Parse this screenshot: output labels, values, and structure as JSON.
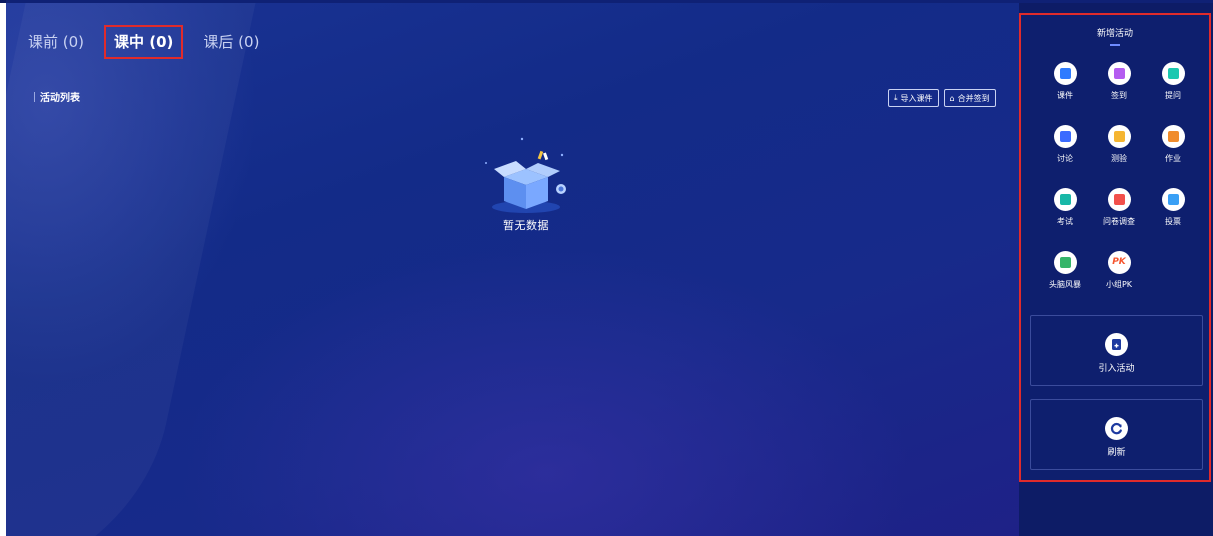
{
  "tabs": [
    {
      "label": "课前 (0)",
      "active": false
    },
    {
      "label": "课中 (0)",
      "active": true
    },
    {
      "label": "课后 (0)",
      "active": false
    }
  ],
  "main": {
    "list_title": "活动列表",
    "import_button": "导入课件",
    "merge_button": "合并签到",
    "empty_text": "暂无数据"
  },
  "panel": {
    "title": "新增活动",
    "activities": [
      {
        "label": "课件",
        "icon": "courseware-icon",
        "color": "#2f7bff"
      },
      {
        "label": "签到",
        "icon": "signin-icon",
        "color": "#b45cf0"
      },
      {
        "label": "提问",
        "icon": "question-icon",
        "color": "#1cc8b0"
      },
      {
        "label": "讨论",
        "icon": "discussion-icon",
        "color": "#3b6bff"
      },
      {
        "label": "测验",
        "icon": "quiz-icon",
        "color": "#f5b531"
      },
      {
        "label": "作业",
        "icon": "homework-icon",
        "color": "#f08c2c"
      },
      {
        "label": "考试",
        "icon": "exam-icon",
        "color": "#19b8a7"
      },
      {
        "label": "问卷调查",
        "icon": "survey-icon",
        "color": "#f2504b"
      },
      {
        "label": "投票",
        "icon": "vote-icon",
        "color": "#3aa0f5"
      },
      {
        "label": "头脑风暴",
        "icon": "brainstorm-icon",
        "color": "#35b56a"
      },
      {
        "label": "小组PK",
        "icon": "group-pk-icon",
        "color": "#f5552e"
      }
    ],
    "import_activity": "引入活动",
    "refresh": "刷新"
  }
}
